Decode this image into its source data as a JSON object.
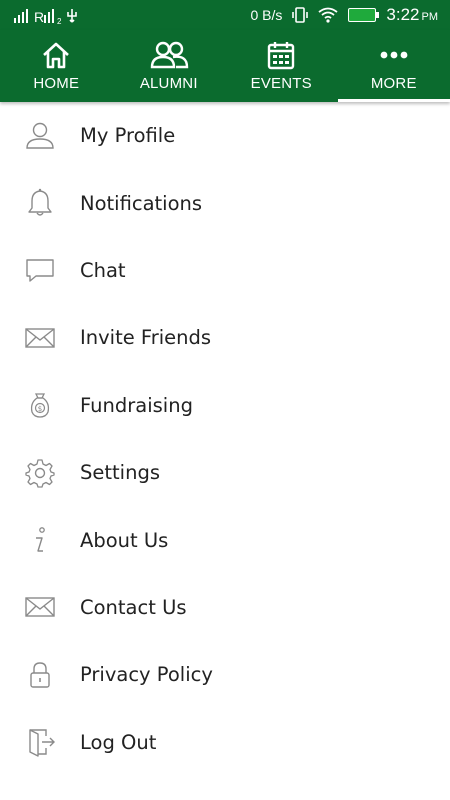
{
  "status_bar": {
    "signal_text": ".ıl, R̈ıl ₂ ψ",
    "speed": "0 B/s",
    "time": "3:22",
    "ampm": "PM"
  },
  "nav": {
    "tabs": [
      {
        "label": "HOME",
        "icon": "home-icon"
      },
      {
        "label": "ALUMNI",
        "icon": "people-icon"
      },
      {
        "label": "EVENTS",
        "icon": "calendar-icon"
      },
      {
        "label": "MORE",
        "icon": "more-dots-icon",
        "active": true
      }
    ]
  },
  "menu": {
    "items": [
      {
        "label": "My Profile",
        "icon": "user-icon"
      },
      {
        "label": "Notifications",
        "icon": "bell-icon"
      },
      {
        "label": "Chat",
        "icon": "chat-bubble-icon"
      },
      {
        "label": "Invite Friends",
        "icon": "envelope-icon"
      },
      {
        "label": "Fundraising",
        "icon": "money-bag-icon"
      },
      {
        "label": "Settings",
        "icon": "gear-icon"
      },
      {
        "label": "About Us",
        "icon": "info-icon"
      },
      {
        "label": "Contact Us",
        "icon": "envelope-icon"
      },
      {
        "label": "Privacy Policy",
        "icon": "lock-icon"
      },
      {
        "label": "Log Out",
        "icon": "logout-icon"
      }
    ]
  },
  "colors": {
    "primary": "#0b6b2e",
    "icon_gray": "#8a8a8a",
    "text": "#222222"
  }
}
